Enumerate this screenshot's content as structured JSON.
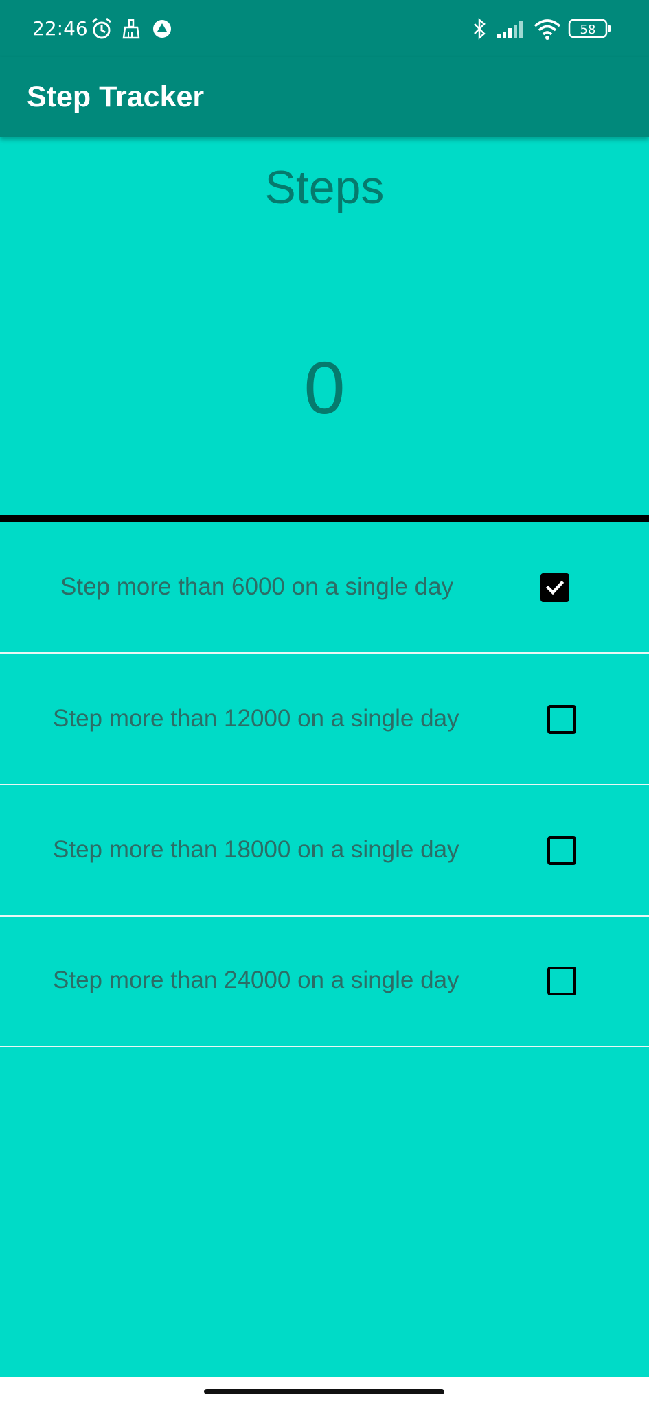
{
  "status_bar": {
    "time": "22:46",
    "icons_left": [
      "alarm-icon",
      "cleaner-icon",
      "app-notification-icon"
    ],
    "icons_right": [
      "bluetooth-icon",
      "signal-icon",
      "wifi-icon",
      "battery-icon"
    ],
    "battery_level": "58"
  },
  "app_bar": {
    "title": "Step Tracker"
  },
  "counter": {
    "label": "Steps",
    "value": "0"
  },
  "goals": [
    {
      "label": "Step more than 6000 on a single day",
      "checked": true
    },
    {
      "label": "Step more than 12000 on a single day",
      "checked": false
    },
    {
      "label": "Step more than 18000 on a single day",
      "checked": false
    },
    {
      "label": "Step more than 24000 on a single day",
      "checked": false
    }
  ],
  "colors": {
    "primary": "#01897b",
    "background": "#00dbc7",
    "text_dark": "#067a6d"
  }
}
